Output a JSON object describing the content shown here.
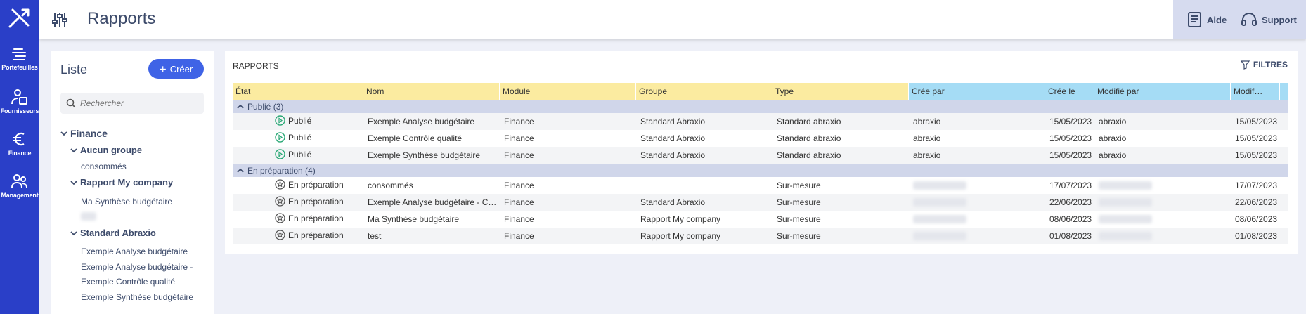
{
  "nav": [
    {
      "label": "Portefeuilles",
      "icon": "portfolio-icon"
    },
    {
      "label": "Fournisseurs",
      "icon": "supplier-icon"
    },
    {
      "label": "Finance",
      "icon": "euro-icon"
    },
    {
      "label": "Management",
      "icon": "people-icon"
    }
  ],
  "header": {
    "title": "Rapports",
    "help": "Aide",
    "support": "Support"
  },
  "list": {
    "title": "Liste",
    "create": "Créer",
    "search_placeholder": "Rechercher",
    "tree": {
      "root": "Finance",
      "g1": "Aucun groupe",
      "g1_items": [
        "consommés"
      ],
      "g2": "Rapport My company",
      "g2_items": [
        "Ma Synthèse budgétaire"
      ],
      "g3": "Standard Abraxio",
      "g3_items": [
        "Exemple Analyse budgétaire",
        "Exemple Analyse budgétaire -",
        "Exemple Contrôle qualité",
        "Exemple Synthèse budgétaire"
      ]
    }
  },
  "reports": {
    "title": "RAPPORTS",
    "filters": "FILTRES",
    "columns": [
      "État",
      "Nom",
      "Module",
      "Groupe",
      "Type",
      "Crée par",
      "Crée le",
      "Modifié par",
      "Modif…"
    ],
    "groups": [
      {
        "label": "Publié (3)",
        "rows": [
          {
            "etat": "Publié",
            "nom": "Exemple Analyse budgétaire",
            "module": "Finance",
            "groupe": "Standard Abraxio",
            "type": "Standard abraxio",
            "cree_par": "abraxio",
            "cree_le": "15/05/2023",
            "modifie_par": "abraxio",
            "modifie_le": "15/05/2023"
          },
          {
            "etat": "Publié",
            "nom": "Exemple Contrôle qualité",
            "module": "Finance",
            "groupe": "Standard Abraxio",
            "type": "Standard abraxio",
            "cree_par": "abraxio",
            "cree_le": "15/05/2023",
            "modifie_par": "abraxio",
            "modifie_le": "15/05/2023"
          },
          {
            "etat": "Publié",
            "nom": "Exemple Synthèse budgétaire",
            "module": "Finance",
            "groupe": "Standard Abraxio",
            "type": "Standard abraxio",
            "cree_par": "abraxio",
            "cree_le": "15/05/2023",
            "modifie_par": "abraxio",
            "modifie_le": "15/05/2023"
          }
        ]
      },
      {
        "label": "En préparation (4)",
        "rows": [
          {
            "etat": "En préparation",
            "nom": "consommés",
            "module": "Finance",
            "groupe": "",
            "type": "Sur-mesure",
            "cree_par": "",
            "cree_le": "17/07/2023",
            "modifie_par": "",
            "modifie_le": "17/07/2023"
          },
          {
            "etat": "En préparation",
            "nom": "Exemple Analyse budgétaire - C…",
            "module": "Finance",
            "groupe": "Standard Abraxio",
            "type": "Sur-mesure",
            "cree_par": "",
            "cree_le": "22/06/2023",
            "modifie_par": "",
            "modifie_le": "22/06/2023"
          },
          {
            "etat": "En préparation",
            "nom": "Ma Synthèse budgétaire",
            "module": "Finance",
            "groupe": "Rapport My company",
            "type": "Sur-mesure",
            "cree_par": "",
            "cree_le": "08/06/2023",
            "modifie_par": "",
            "modifie_le": "08/06/2023"
          },
          {
            "etat": "En préparation",
            "nom": "test",
            "module": "Finance",
            "groupe": "Rapport My company",
            "type": "Sur-mesure",
            "cree_par": "",
            "cree_le": "01/08/2023",
            "modifie_par": "",
            "modifie_le": "01/08/2023"
          }
        ]
      }
    ]
  },
  "colors": {
    "nav_bg": "#2a3fc8",
    "accent": "#3f63e6",
    "header_yellow": "#fbeba0",
    "header_blue": "#a5dcf5",
    "status_published": "#2aa876"
  }
}
